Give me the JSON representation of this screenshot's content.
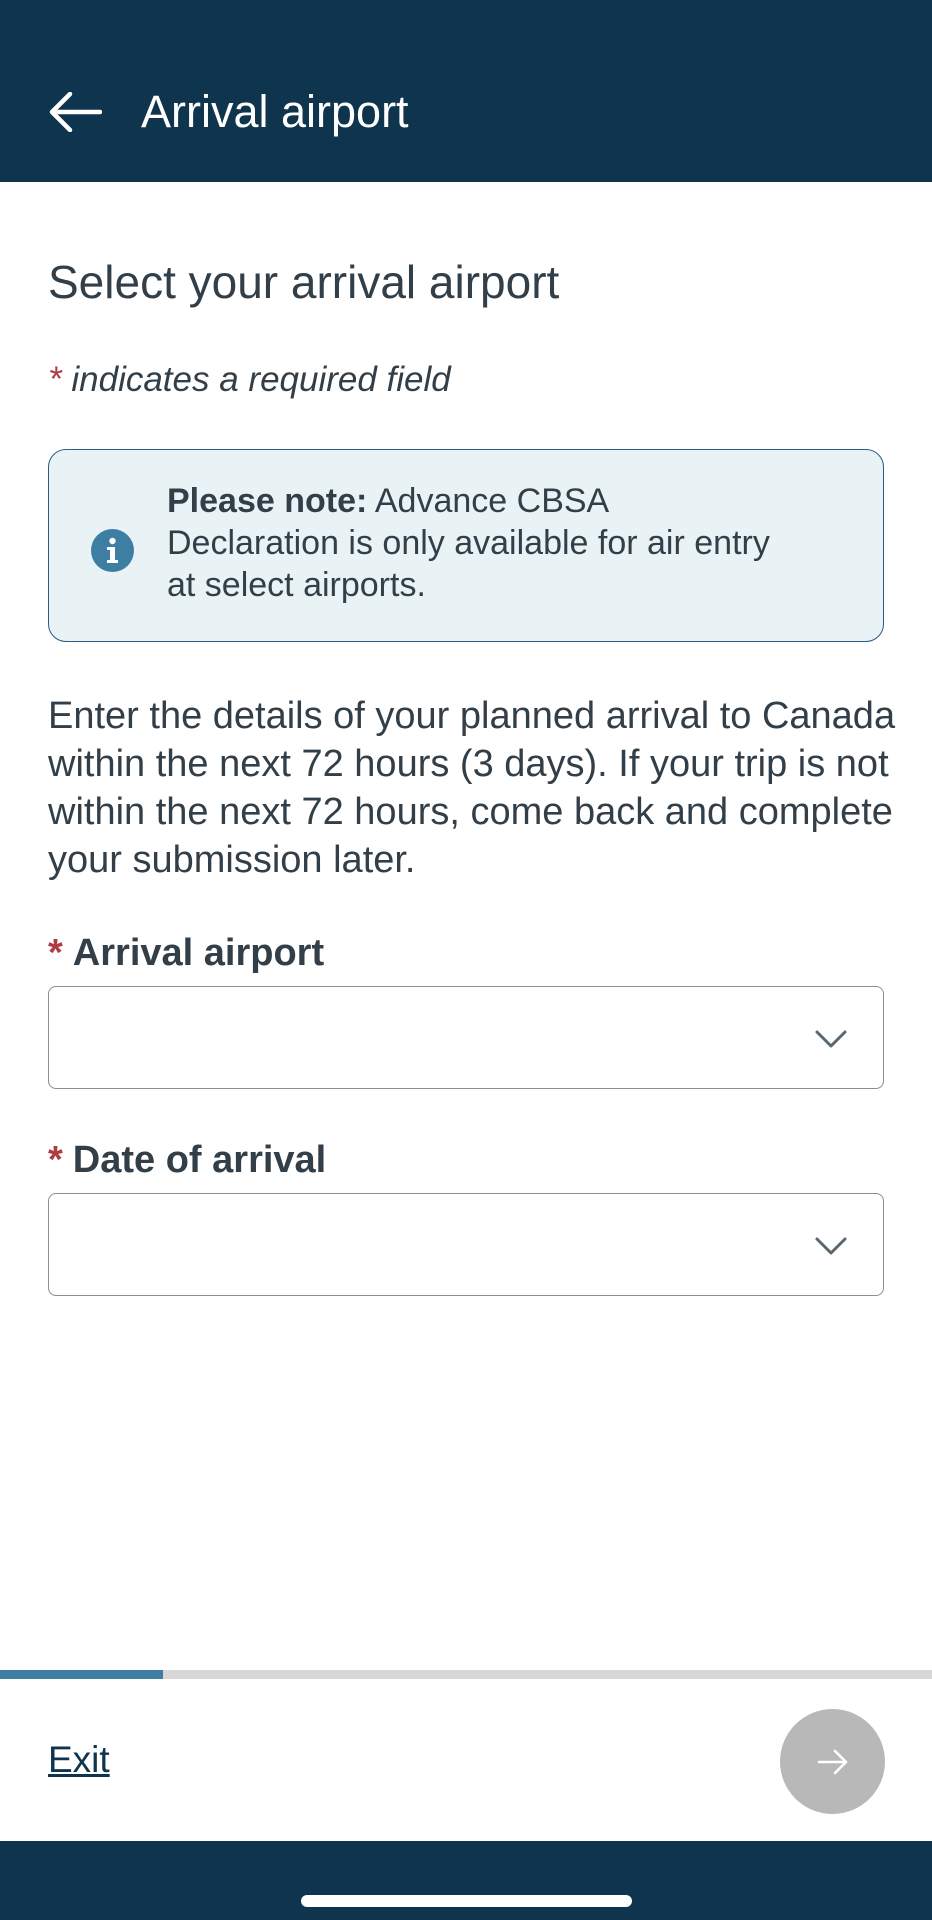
{
  "header": {
    "title": "Arrival airport",
    "back_icon": "arrow-left-icon",
    "background_color": "#0f344d"
  },
  "page": {
    "title": "Select your arrival airport",
    "required_star": "*",
    "required_note": "indicates a required field"
  },
  "note": {
    "icon": "info-icon",
    "bold_prefix": "Please note:",
    "text": " Advance CBSA Declaration is only available for air entry at select airports."
  },
  "intro": "Enter the details of your planned arrival to Canada within the next 72 hours (3 days). If your trip is not within the next 72 hours, come back and complete your submission later.",
  "fields": [
    {
      "star": "*",
      "label": "Arrival airport",
      "value": "",
      "icon": "chevron-down-icon"
    },
    {
      "star": "*",
      "label": "Date of arrival",
      "value": "",
      "icon": "chevron-down-icon"
    }
  ],
  "progress": {
    "fraction": 0.175,
    "color": "#3f7ea3"
  },
  "footer": {
    "exit_label": "Exit",
    "next_icon": "arrow-right-icon",
    "next_enabled": false
  },
  "colors": {
    "accent": "#0f344d",
    "required": "#af3c43",
    "note_background": "#e9f2f5"
  }
}
